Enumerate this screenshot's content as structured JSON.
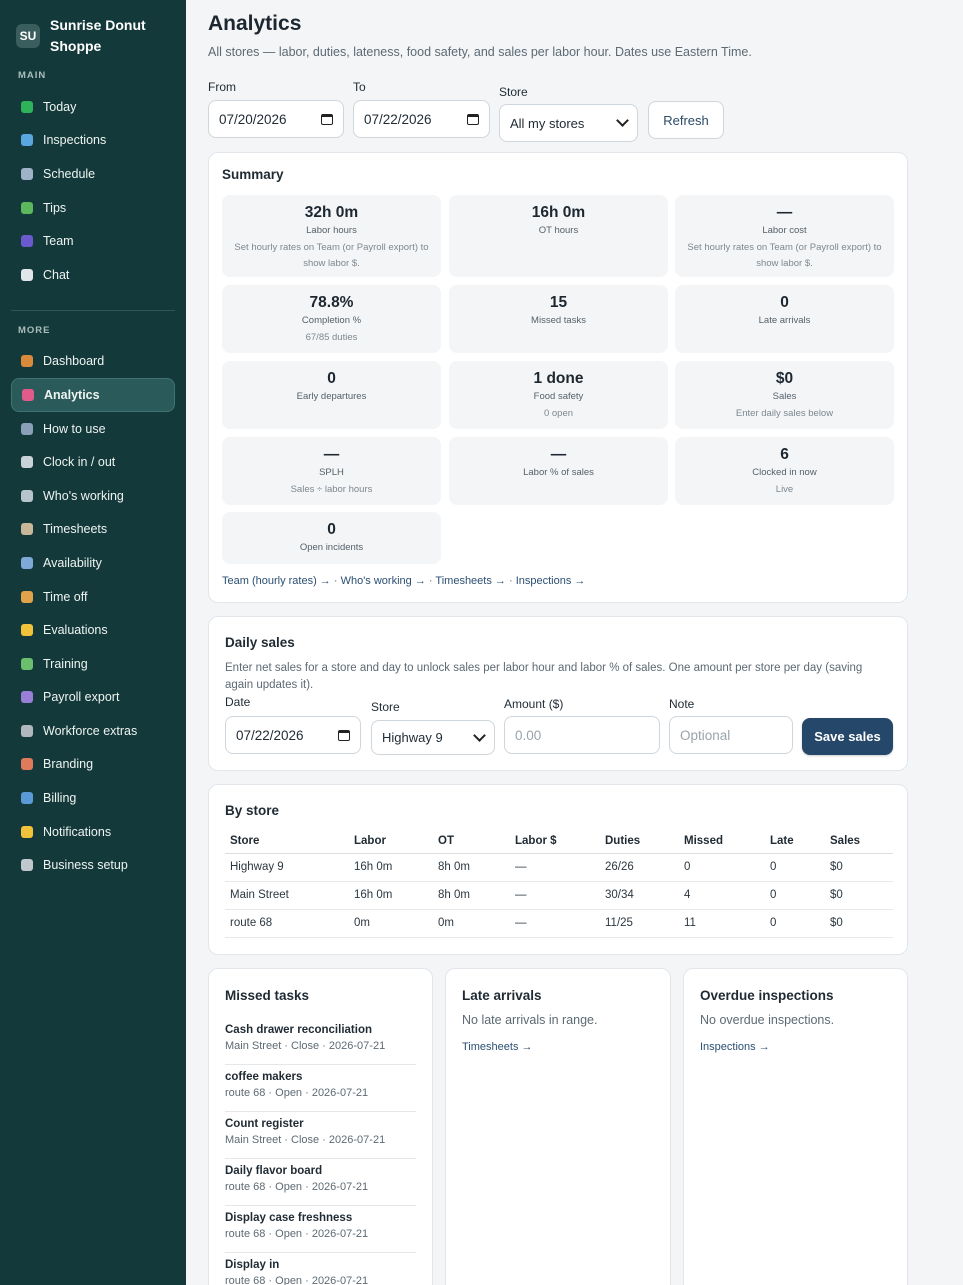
{
  "brand": {
    "initials": "SU",
    "name": "Sunrise Donut Shoppe"
  },
  "sidebar": {
    "main_label": "MAIN",
    "more_label": "MORE",
    "main_items": [
      {
        "label": "Today",
        "icon": "check-box-icon",
        "color": "#2fb35a"
      },
      {
        "label": "Inspections",
        "icon": "magnifier-icon",
        "color": "#5aa7e0"
      },
      {
        "label": "Schedule",
        "icon": "calendar-icon",
        "color": "#9fb3c8"
      },
      {
        "label": "Tips",
        "icon": "money-icon",
        "color": "#5cb85c"
      },
      {
        "label": "Team",
        "icon": "people-icon",
        "color": "#6a5acd"
      },
      {
        "label": "Chat",
        "icon": "speech-bubble-icon",
        "color": "#e0e6ea"
      }
    ],
    "more_items": [
      {
        "label": "Dashboard",
        "icon": "house-icon",
        "color": "#d98a3a"
      },
      {
        "label": "Analytics",
        "icon": "bar-chart-icon",
        "color": "#e05a8a",
        "active": true
      },
      {
        "label": "How to use",
        "icon": "book-icon",
        "color": "#8aa0b8"
      },
      {
        "label": "Clock in / out",
        "icon": "clock-icon",
        "color": "#c9d2d8"
      },
      {
        "label": "Who's working",
        "icon": "id-card-icon",
        "color": "#b8c4cc"
      },
      {
        "label": "Timesheets",
        "icon": "clipboard-icon",
        "color": "#c8b89a"
      },
      {
        "label": "Availability",
        "icon": "calendar-grid-icon",
        "color": "#7fa8d6"
      },
      {
        "label": "Time off",
        "icon": "beach-icon",
        "color": "#e0a24a"
      },
      {
        "label": "Evaluations",
        "icon": "star-icon",
        "color": "#f2c23a"
      },
      {
        "label": "Training",
        "icon": "books-icon",
        "color": "#6cbf6c"
      },
      {
        "label": "Payroll export",
        "icon": "floppy-icon",
        "color": "#9a7fd6"
      },
      {
        "label": "Workforce extras",
        "icon": "puzzle-icon",
        "color": "#b0b8be"
      },
      {
        "label": "Branding",
        "icon": "palette-icon",
        "color": "#e07a5a"
      },
      {
        "label": "Billing",
        "icon": "credit-card-icon",
        "color": "#5a9ad6"
      },
      {
        "label": "Notifications",
        "icon": "bell-icon",
        "color": "#f2c23a"
      },
      {
        "label": "Business setup",
        "icon": "gear-icon",
        "color": "#c0c8ce"
      }
    ]
  },
  "header": {
    "title": "Analytics",
    "subtitle": "All stores — labor, duties, lateness, food safety, and sales per labor hour. Dates use Eastern Time."
  },
  "filters": {
    "from_label": "From",
    "from_value": "07/20/2026",
    "to_label": "To",
    "to_value": "07/22/2026",
    "store_label": "Store",
    "store_value": "All my stores",
    "refresh_label": "Refresh"
  },
  "summary": {
    "title": "Summary",
    "stats": [
      {
        "value": "32h 0m",
        "label": "Labor hours",
        "sub": "Set hourly rates on Team (or Payroll export) to show labor $."
      },
      {
        "value": "16h 0m",
        "label": "OT hours",
        "sub": ""
      },
      {
        "value": "—",
        "label": "Labor cost",
        "sub": "Set hourly rates on Team (or Payroll export) to show labor $."
      },
      {
        "value": "78.8%",
        "label": "Completion %",
        "sub": "67/85 duties"
      },
      {
        "value": "15",
        "label": "Missed tasks",
        "sub": ""
      },
      {
        "value": "0",
        "label": "Late arrivals",
        "sub": ""
      },
      {
        "value": "0",
        "label": "Early departures",
        "sub": ""
      },
      {
        "value": "1 done",
        "label": "Food safety",
        "sub": "0 open"
      },
      {
        "value": "$0",
        "label": "Sales",
        "sub": "Enter daily sales below"
      },
      {
        "value": "—",
        "label": "SPLH",
        "sub": "Sales ÷ labor hours"
      },
      {
        "value": "—",
        "label": "Labor % of sales",
        "sub": ""
      },
      {
        "value": "6",
        "label": "Clocked in now",
        "sub": "Live"
      },
      {
        "value": "0",
        "label": "Open incidents",
        "sub": ""
      }
    ],
    "links": [
      "Team (hourly rates) →",
      "Who's working →",
      "Timesheets →",
      "Inspections →"
    ],
    "link_sep": " · "
  },
  "daily_sales": {
    "title": "Daily sales",
    "description": "Enter net sales for a store and day to unlock sales per labor hour and labor % of sales. One amount per store per day (saving again updates it).",
    "date_label": "Date",
    "date_value": "07/22/2026",
    "store_label": "Store",
    "store_value": "Highway 9",
    "amount_label": "Amount ($)",
    "amount_placeholder": "0.00",
    "note_label": "Note",
    "note_placeholder": "Optional",
    "save_label": "Save sales"
  },
  "by_store": {
    "title": "By store",
    "columns": [
      "Store",
      "Labor",
      "OT",
      "Labor $",
      "Duties",
      "Missed",
      "Late",
      "Sales"
    ],
    "rows": [
      [
        "Highway 9",
        "16h 0m",
        "8h 0m",
        "—",
        "26/26",
        "0",
        "0",
        "$0"
      ],
      [
        "Main Street",
        "16h 0m",
        "8h 0m",
        "—",
        "30/34",
        "4",
        "0",
        "$0"
      ],
      [
        "route 68",
        "0m",
        "0m",
        "—",
        "11/25",
        "11",
        "0",
        "$0"
      ]
    ]
  },
  "missed_tasks": {
    "title": "Missed tasks",
    "items": [
      {
        "name": "Cash drawer reconciliation",
        "meta": "Main Street · Close · 2026-07-21"
      },
      {
        "name": "coffee makers",
        "meta": "route 68 · Open · 2026-07-21"
      },
      {
        "name": "Count register",
        "meta": "Main Street · Close · 2026-07-21"
      },
      {
        "name": "Daily flavor board",
        "meta": "route 68 · Open · 2026-07-21"
      },
      {
        "name": "Display case freshness",
        "meta": "route 68 · Open · 2026-07-21"
      },
      {
        "name": "Display in",
        "meta": "route 68 · Open · 2026-07-21"
      }
    ]
  },
  "late_arrivals": {
    "title": "Late arrivals",
    "empty": "No late arrivals in range.",
    "link": "Timesheets →"
  },
  "overdue_inspections": {
    "title": "Overdue inspections",
    "empty": "No overdue inspections.",
    "link": "Inspections →"
  }
}
